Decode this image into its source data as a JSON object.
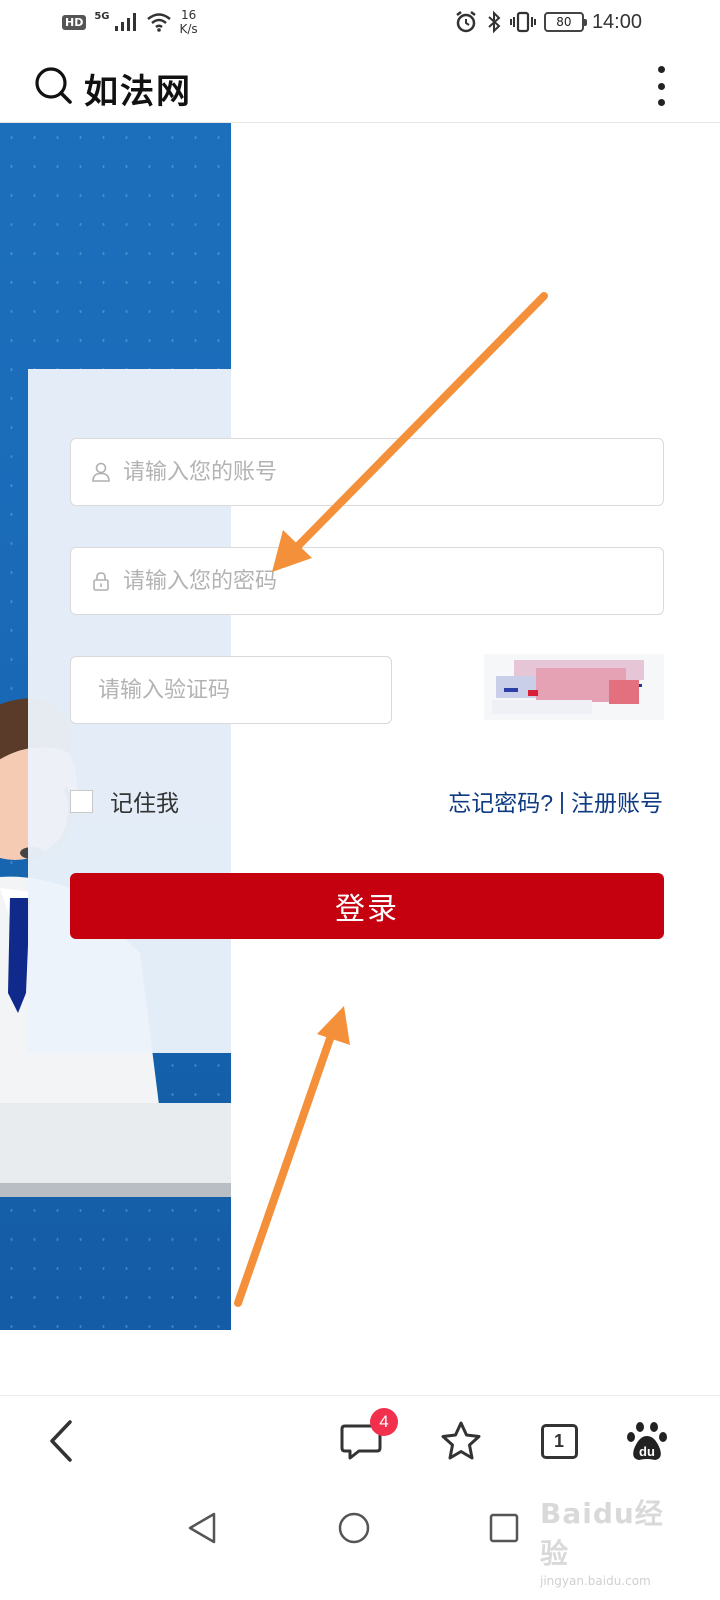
{
  "status_bar": {
    "hd": "HD",
    "network": "5G",
    "speed_value": "16",
    "speed_unit": "K/s",
    "battery": "80",
    "time": "14:00"
  },
  "header": {
    "title": "如法网"
  },
  "login_form": {
    "username_placeholder": "请输入您的账号",
    "password_placeholder": "请输入您的密码",
    "captcha_placeholder": "请输入验证码",
    "remember_label": "记住我",
    "forgot_link": "忘记密码?",
    "link_separator": "|",
    "register_link": "注册账号",
    "login_button": "登录"
  },
  "toolbar": {
    "message_badge": "4",
    "tab_count": "1"
  },
  "watermark": {
    "logo": "Baidu经验",
    "url": "jingyan.baidu.com"
  },
  "colors": {
    "accent_red": "#c5000f",
    "link_blue": "#0f3b82",
    "banner_blue": "#1a6ab8",
    "annotation_orange": "#f5903a",
    "badge_red": "#f2304e"
  }
}
